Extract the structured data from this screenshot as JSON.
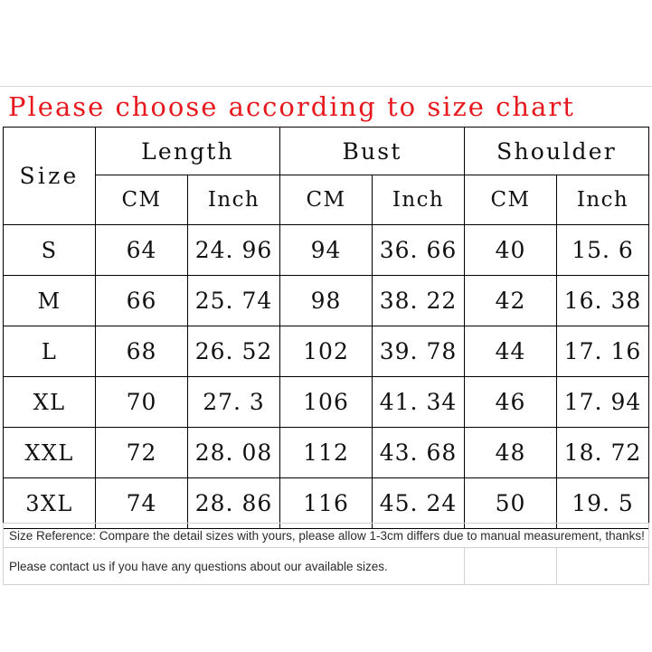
{
  "title": "Please choose according to size chart",
  "theme": {
    "title_color": "#e8191e",
    "grid_line_color": "#000000",
    "note_line_color": "#d2d2d2",
    "background": "#ffffff"
  },
  "table": {
    "size_header": "Size",
    "groups": [
      {
        "label": "Length",
        "units": [
          "CM",
          "Inch"
        ]
      },
      {
        "label": "Bust",
        "units": [
          "CM",
          "Inch"
        ]
      },
      {
        "label": "Shoulder",
        "units": [
          "CM",
          "Inch"
        ]
      }
    ],
    "rows": [
      {
        "size": "S",
        "length_cm": "64",
        "length_in": "24. 96",
        "bust_cm": "94",
        "bust_in": "36. 66",
        "shoulder_cm": "40",
        "shoulder_in": "15. 6"
      },
      {
        "size": "M",
        "length_cm": "66",
        "length_in": "25. 74",
        "bust_cm": "98",
        "bust_in": "38. 22",
        "shoulder_cm": "42",
        "shoulder_in": "16. 38"
      },
      {
        "size": "L",
        "length_cm": "68",
        "length_in": "26. 52",
        "bust_cm": "102",
        "bust_in": "39. 78",
        "shoulder_cm": "44",
        "shoulder_in": "17. 16"
      },
      {
        "size": "XL",
        "length_cm": "70",
        "length_in": "27. 3",
        "bust_cm": "106",
        "bust_in": "41. 34",
        "shoulder_cm": "46",
        "shoulder_in": "17. 94"
      },
      {
        "size": "XXL",
        "length_cm": "72",
        "length_in": "28. 08",
        "bust_cm": "112",
        "bust_in": "43. 68",
        "shoulder_cm": "48",
        "shoulder_in": "18. 72"
      },
      {
        "size": "3XL",
        "length_cm": "74",
        "length_in": "28. 86",
        "bust_cm": "116",
        "bust_in": "45. 24",
        "shoulder_cm": "50",
        "shoulder_in": "19. 5"
      }
    ]
  },
  "notes": {
    "reference": "Size Reference: Compare the detail sizes with yours, please allow 1-3cm differs due to manual measurement, thanks!",
    "contact": "Please contact us if you have any questions about our available sizes."
  }
}
